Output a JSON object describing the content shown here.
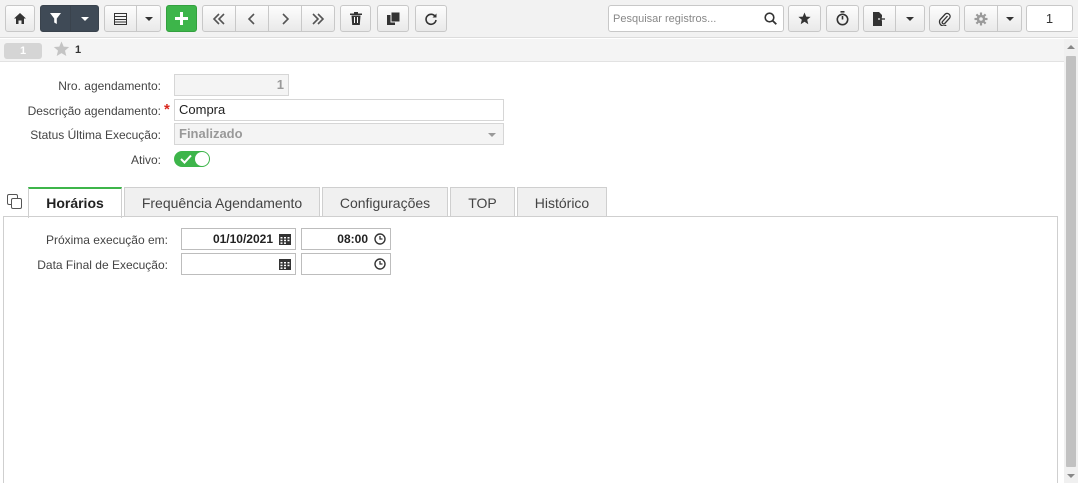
{
  "toolbar": {
    "search_placeholder": "Pesquisar registros...",
    "page_number": "1"
  },
  "record_bar": {
    "badge": "1",
    "number": "1"
  },
  "form": {
    "nro_label": "Nro. agendamento:",
    "nro_value": "1",
    "descricao_label": "Descrição agendamento:",
    "descricao_value": "Compra",
    "status_label": "Status Última Execução:",
    "status_value": "Finalizado",
    "ativo_label": "Ativo:"
  },
  "tabs": [
    {
      "label": "Horários"
    },
    {
      "label": "Frequência Agendamento"
    },
    {
      "label": "Configurações"
    },
    {
      "label": "TOP"
    },
    {
      "label": "Histórico"
    }
  ],
  "horarios": {
    "proxima_label": "Próxima execução em:",
    "proxima_date": "01/10/2021",
    "proxima_time": "08:00",
    "final_label": "Data Final de Execução:",
    "final_date": "",
    "final_time": ""
  },
  "colors": {
    "accent_green": "#3db54a",
    "toolbar_dark": "#3f4a56",
    "required_red": "#d9261c"
  }
}
